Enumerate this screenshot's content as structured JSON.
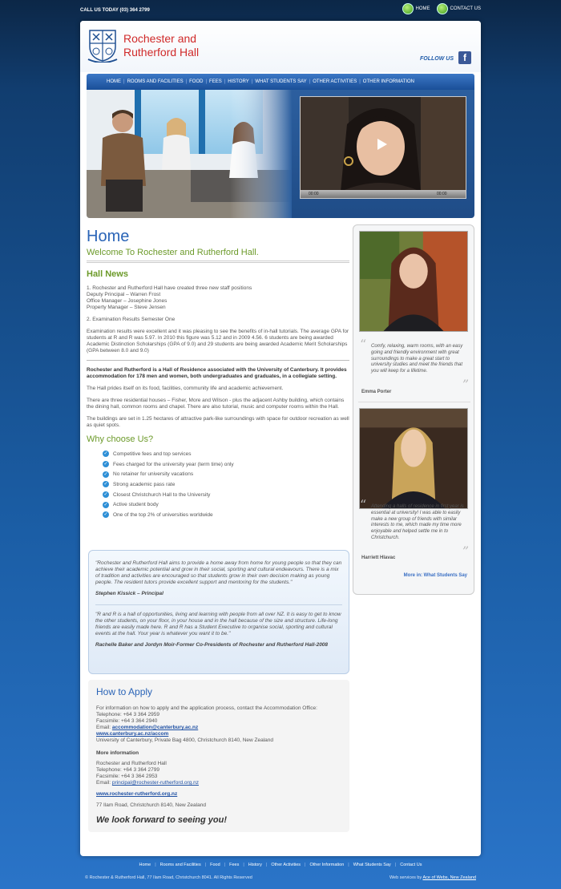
{
  "topbar": {
    "call": "CALL US TODAY (03) 364 2799",
    "home": "HOME",
    "contact": "CONTACT US"
  },
  "header": {
    "logo_line1": "Rochester and",
    "logo_line2": "Rutherford Hall",
    "follow": "FOLLOW US",
    "fb": "f"
  },
  "nav": [
    "HOME",
    "ROOMS AND FACILITIES",
    "FOOD",
    "FEES",
    "HISTORY",
    "WHAT STUDENTS SAY",
    "OTHER ACTIVITIES",
    "OTHER INFORMATION"
  ],
  "video": {
    "time_start": "00:00",
    "time_end": "00:00"
  },
  "main": {
    "title": "Home",
    "welcome": "Welcome To Rochester and Rutherford Hall.",
    "hall_news": "Hall News",
    "news1_l1": "1. Rochester and Rutherford Hall have created three new staff positions",
    "news1_l2": "Deputy Principal – Warren Frost",
    "news1_l3": "Office Manager – Josephine Jones",
    "news1_l4": "Property Manager – Steve Jensen",
    "news2": "2. Examination Results Semester One",
    "news3": "Examination results were excellent and it was pleasing to see the benefits of in-hall tutorials. The average GPA for students at R and R was 5.97. In 2010 this figure was 5.12 and in 2009 4.56. 6 students are being awarded Academic Distinction Scholarships (GPA of 9.0) and 29 students are being awarded Academic Merit Scholarships (GPA between 8.0 and 9.0)",
    "intro_bold": "Rochester and Rutherford is a Hall of Residence associated with the University of Canterbury. It provides accommodation for 178 men and women, both undergraduates and graduates, in a collegiate setting.",
    "p1": "The Hall prides itself on its food, facilities, community life and academic achievement.",
    "p2": "There are three residential houses – Fisher, More and Wilson - plus the adjacent Ashby building, which contains the dining hall, common rooms and chapel. There are also tutorial, music and computer rooms within the Hall.",
    "p3": "The buildings are set in 1.25 hectares of attractive park-like surroundings with space for outdoor recreation as well as quiet spots.",
    "why": "Why choose Us?",
    "reasons": [
      "Competitive fees and top services",
      "Fees charged for the university year (term time) only",
      "No retainer for university vacations",
      "Strong academic pass rate",
      "Closest Christchurch Hall to the University",
      "Active student body",
      "One of the top 2% of universities worldwide"
    ]
  },
  "quotes": {
    "q1": "\"Rochester and Rutherford Hall aims to provide a home away from home for young people so that they can achieve their academic potential and grow in their social, sporting and cultural endeavours. There is a mix of tradition and activities are encouraged so that students grow in their own decision making as young people. The resident tutors provide excellent support and mentoring for the students.\"",
    "a1": "Stephen Kissick – Principal",
    "q2": "\"R and R is a hall of opportunities, living and learning with people from all over NZ. It is easy to get to know the other students, on your floor, in your house and in the hall because of the size and structure. Life-long friends are easily made here. R and R has a Student Executive to organise social, sporting and cultural events at the hall. Your year is whatever you want it to be.\"",
    "a2": "Rachelle Baker and Jordyn Moir-Former Co-Presidents of Rochester and Rutherford Hall-2008"
  },
  "apply": {
    "title": "How to Apply",
    "l1": "For information on how to apply and the application process, contact the Accommodation Office:",
    "l2": "Telephone: +64 3 364 2959",
    "l3": "Facsimile: +64 3 364 2940",
    "email_label": "Email: ",
    "email": "accommodation@canterbury.ac.nz",
    "web": "www.canterbury.ac.nz/accom",
    "l4": "University of Canterbury, Private Bag 4800, Christchurch 8140, New Zealand",
    "more": "More information",
    "m1": "Rochester and Rutherford Hall",
    "m2": "Telephone: +64 3 364 2799",
    "m3": "Facsimile: +64 3 364 2953",
    "m_email_label": "Email: ",
    "m_email": "principal@rochester-rutherford.org.nz",
    "m_web": "www.rochester-rutherford.org.nz",
    "m_addr": "77 Ilam Road, Christchurch 8140, New Zealand",
    "look": "We look forward to seeing you!"
  },
  "sidebar": {
    "t1": "Comfy, relaxing, warm rooms, with an easy going and friendly environment with great surroundings to make a great start to university studies and meet the friends that you will keep for a lifetime.",
    "n1": "Emma Porter",
    "t2": "Attending a halls of residence in first year is essential at university! I was able to easily make a new group of friends with similar interests to me, which made my time more enjoyable and helped settle me in to Christchurch.",
    "n2": "Harriett Hlavac",
    "more": "More in: What Students Say"
  },
  "footer": {
    "nav": [
      "Home",
      "Rooms and Facilities",
      "Food",
      "Fees",
      "History",
      "Other Activities",
      "Other Information",
      "What Students Say",
      "Contact Us"
    ],
    "copy": "© Rochester & Rutherford Hall, 77 Ilam Road, Christchurch 8041. All Rights Reserved",
    "web_label": "Web services by ",
    "web_link": "Ace of Webs, New Zealand"
  },
  "colors": {
    "accent_blue": "#2a64b7",
    "green": "#6c9a2a",
    "logo_red": "#d02a2a"
  }
}
